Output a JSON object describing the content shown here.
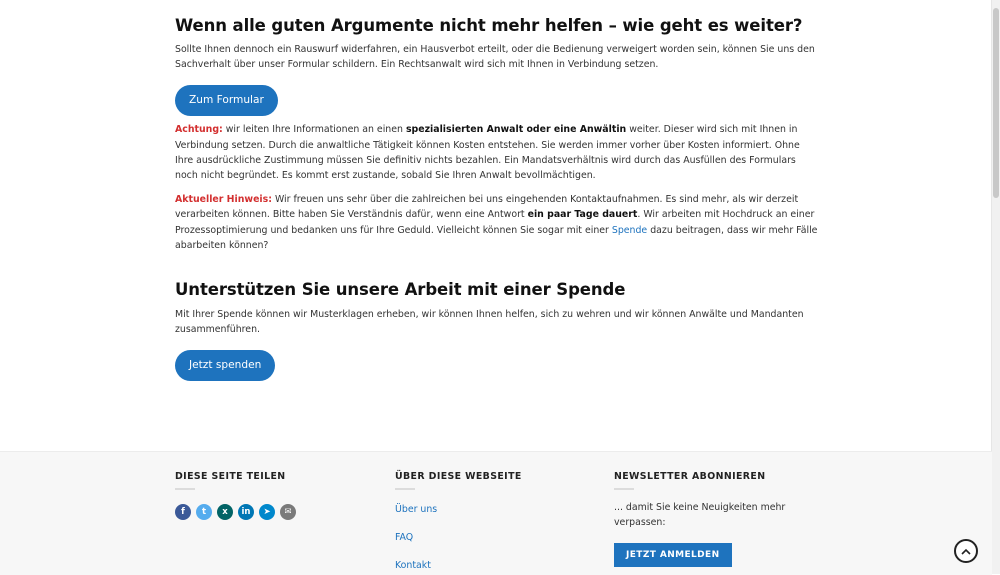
{
  "section1": {
    "heading": "Wenn alle guten Argumente nicht mehr helfen – wie geht es weiter?",
    "intro": "Sollte Ihnen dennoch ein Rauswurf widerfahren, ein Hausverbot erteilt, oder die Bedienung verweigert worden sein, können Sie uns den Sachverhalt über unser Formular schildern. Ein Rechtsanwalt wird sich mit Ihnen in Verbindung setzen.",
    "button": "Zum Formular"
  },
  "achtung": {
    "label": "Achtung:",
    "text1": " wir leiten Ihre Informationen an einen ",
    "bold": "spezialisierten Anwalt oder eine Anwältin",
    "text2": " weiter. Dieser wird sich mit Ihnen in Verbindung setzen. Durch die anwaltliche Tätigkeit können Kosten entstehen. Sie werden immer vorher über Kosten informiert. Ohne Ihre ausdrückliche Zustimmung müssen Sie definitiv nichts bezahlen. Ein Mandatsverhältnis wird durch das Ausfüllen des Formulars noch nicht begründet. Es kommt erst zustande, sobald Sie Ihren Anwalt bevollmächtigen."
  },
  "hinweis": {
    "label": "Aktueller Hinweis:",
    "text1": " Wir freuen uns sehr über die zahlreichen bei uns eingehenden Kontaktaufnahmen. Es sind mehr, als wir derzeit verarbeiten können. Bitte haben Sie Verständnis dafür, wenn eine Antwort ",
    "bold": "ein paar Tage dauert",
    "text2": ". Wir arbeiten mit Hochdruck an einer Prozessoptimierung und bedanken uns für Ihre Geduld. Vielleicht können Sie sogar mit einer ",
    "link": "Spende",
    "text3": " dazu beitragen, dass wir mehr Fälle abarbeiten können?"
  },
  "section2": {
    "heading": "Unterstützen Sie unsere Arbeit mit einer Spende",
    "text": "Mit Ihrer Spende können wir Musterklagen erheben, wir können Ihnen helfen, sich zu wehren und wir können Anwälte und Mandanten zusammenführen.",
    "button": "Jetzt spenden"
  },
  "footer": {
    "share": {
      "title": "DIESE SEITE TEILEN",
      "icons": [
        {
          "name": "facebook-icon",
          "glyph": "f",
          "color": "#3b5998"
        },
        {
          "name": "twitter-icon",
          "glyph": "t",
          "color": "#55acee"
        },
        {
          "name": "xing-icon",
          "glyph": "x",
          "color": "#026466"
        },
        {
          "name": "linkedin-icon",
          "glyph": "in",
          "color": "#0077b5"
        },
        {
          "name": "telegram-icon",
          "glyph": "➤",
          "color": "#0088cc"
        },
        {
          "name": "email-icon",
          "glyph": "✉",
          "color": "#7a7a7a"
        }
      ]
    },
    "about": {
      "title": "ÜBER DIESE WEBSEITE",
      "links": [
        "Über uns",
        "FAQ",
        "Kontakt"
      ]
    },
    "newsletter": {
      "title": "NEWSLETTER ABONNIEREN",
      "text": "... damit Sie keine Neuigkeiten mehr verpassen:",
      "button": "JETZT ANMELDEN"
    }
  }
}
